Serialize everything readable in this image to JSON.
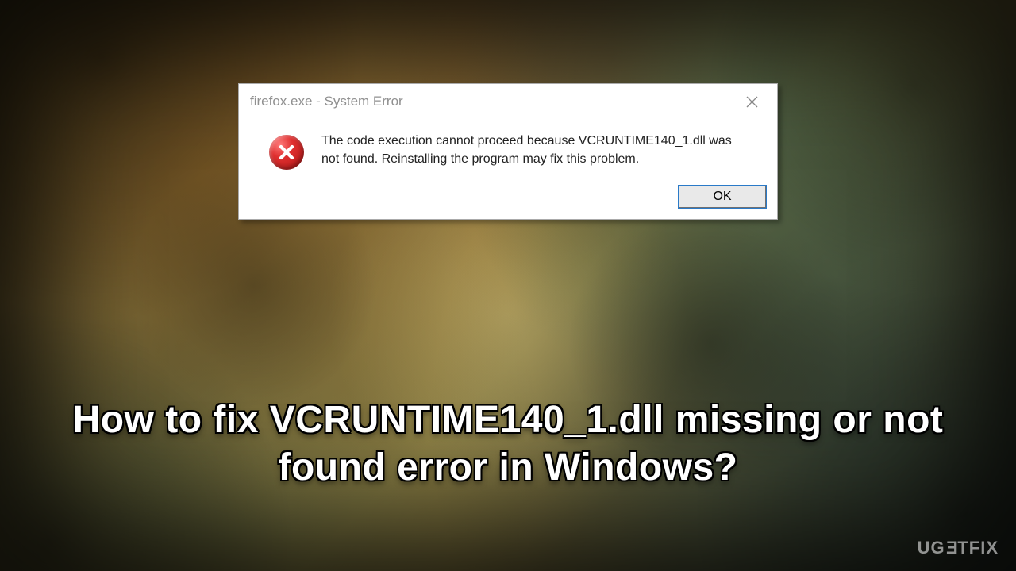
{
  "dialog": {
    "title": "firefox.exe - System Error",
    "message": "The code execution cannot proceed because VCRUNTIME140_1.dll was not found. Reinstalling the program may fix this problem.",
    "ok_label": "OK"
  },
  "headline": {
    "text": "How to fix VCRUNTIME140_1.dll missing or not found error in Windows?"
  },
  "watermark": {
    "prefix": "UG",
    "flip_char": "E",
    "suffix": "TFIX"
  }
}
